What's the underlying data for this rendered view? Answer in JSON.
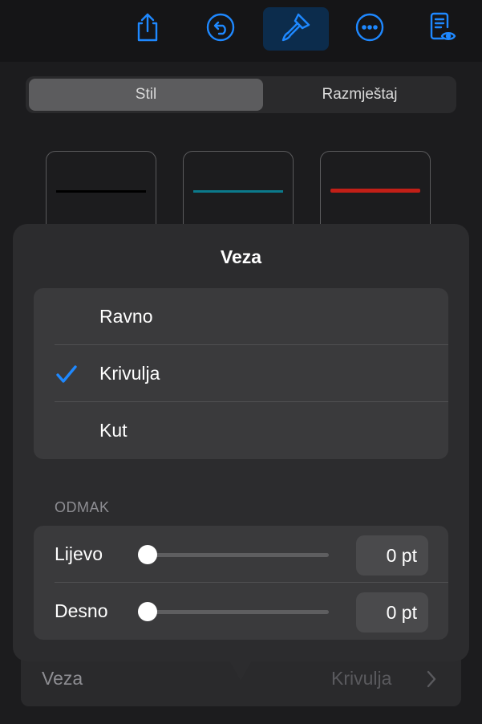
{
  "toolbar": {
    "icons": [
      "share-icon",
      "undo-icon",
      "paintbrush-icon",
      "more-icon",
      "reader-view-icon"
    ],
    "active": "paintbrush-icon",
    "accent": "#1e88ff"
  },
  "segmented": {
    "tabs": [
      "Stil",
      "Razmještaj"
    ],
    "selected": "Stil"
  },
  "line_styles": [
    {
      "color": "#000000"
    },
    {
      "color": "#0b7a8c"
    },
    {
      "color": "#c21f17"
    }
  ],
  "popover": {
    "title": "Veza",
    "options": [
      {
        "label": "Ravno",
        "checked": false
      },
      {
        "label": "Krivulja",
        "checked": true
      },
      {
        "label": "Kut",
        "checked": false
      }
    ],
    "offset_header": "ODMAK",
    "offsets": [
      {
        "label": "Lijevo",
        "value": "0 pt",
        "slider_level": 0
      },
      {
        "label": "Desno",
        "value": "0 pt",
        "slider_level": 0
      }
    ]
  },
  "connection_row": {
    "label": "Veza",
    "value": "Krivulja"
  }
}
